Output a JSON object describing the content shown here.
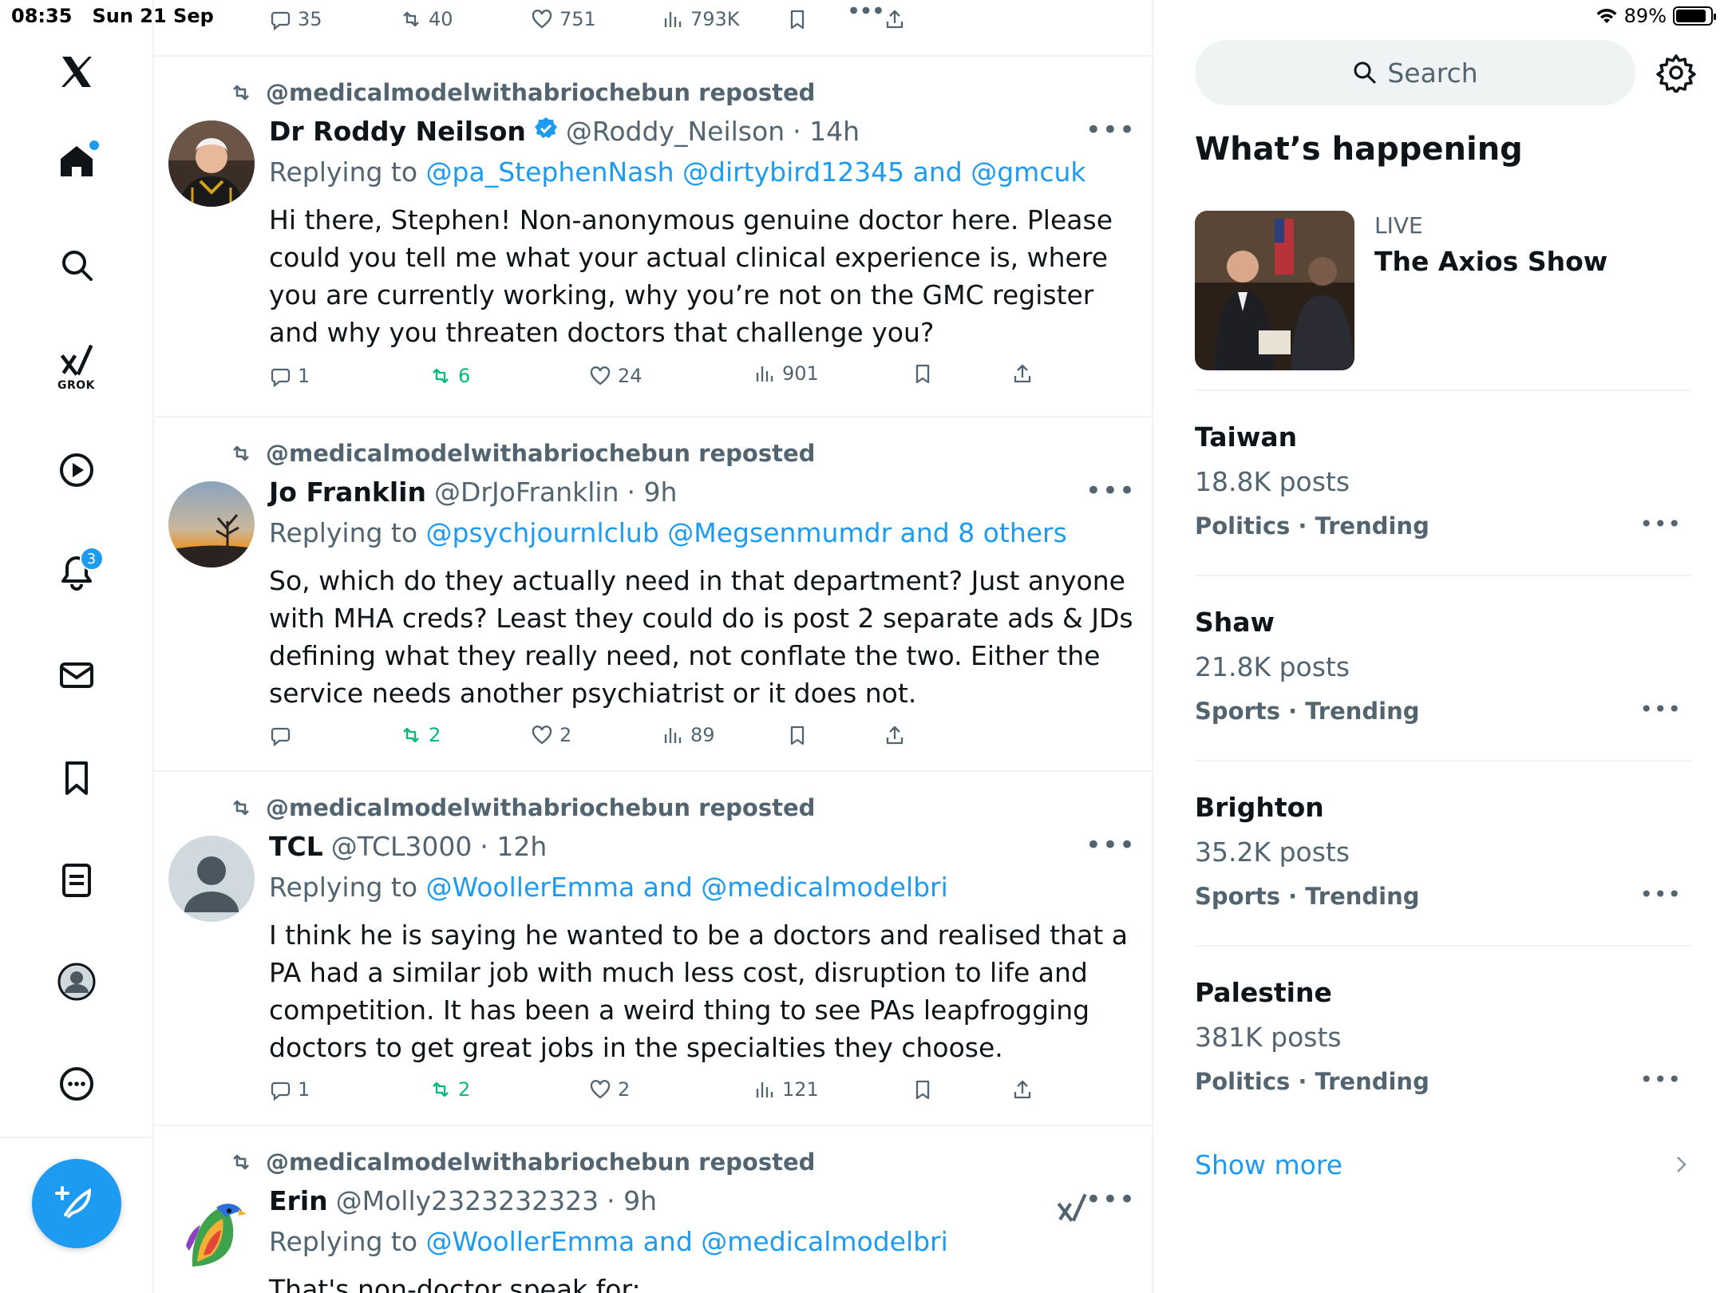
{
  "status_bar": {
    "time": "08:35",
    "date": "Sun 21 Sep",
    "battery": "89%",
    "battery_level": 0.89
  },
  "sidebar": {
    "items": [
      {
        "name": "logo",
        "label": ""
      },
      {
        "name": "home",
        "label": ""
      },
      {
        "name": "explore",
        "label": ""
      },
      {
        "name": "grok",
        "label": "GROK"
      },
      {
        "name": "videos",
        "label": ""
      },
      {
        "name": "notifications",
        "label": "",
        "badge": "3"
      },
      {
        "name": "messages",
        "label": ""
      },
      {
        "name": "bookmarks",
        "label": ""
      },
      {
        "name": "lists",
        "label": ""
      },
      {
        "name": "profile",
        "label": ""
      },
      {
        "name": "more",
        "label": ""
      }
    ]
  },
  "top_post_actions": {
    "replies": "35",
    "reposts": "40",
    "likes": "751",
    "views": "793K"
  },
  "posts": [
    {
      "reposted_by": "@medicalmodelwithabriochebun reposted",
      "author": "Dr Roddy Neilson",
      "verified": true,
      "handle": "@Roddy_Neilson",
      "time": "· 14h",
      "replying_prefix": "Replying to",
      "replying_to": "@pa_StephenNash @dirtybird12345 and @gmcuk",
      "text": "Hi there, Stephen! Non-anonymous genuine doctor here. Please could you tell me what your actual clinical experience is, where you are currently working, why you’re not on the GMC register and why you threaten doctors that challenge you?",
      "replies": "1",
      "reposts": "6",
      "likes": "24",
      "views": "901"
    },
    {
      "reposted_by": "@medicalmodelwithabriochebun reposted",
      "author": "Jo Franklin",
      "verified": false,
      "handle": "@DrJoFranklin",
      "time": "· 9h",
      "replying_prefix": "Replying to",
      "replying_to": "@psychjournlclub @Megsenmumdr and 8 others",
      "text": "So, which do they actually need in that department? Just anyone with MHA creds? Least they could do is post 2 separate ads & JDs defining what they really need, not conflate the two. Either the service needs another psychiatrist or it does not.",
      "replies": "",
      "reposts": "2",
      "likes": "2",
      "views": "89"
    },
    {
      "reposted_by": "@medicalmodelwithabriochebun reposted",
      "author": "TCL",
      "verified": false,
      "handle": "@TCL3000",
      "time": "· 12h",
      "replying_prefix": "Replying to",
      "replying_to": "@WoollerEmma and @medicalmodelbri",
      "text": "I think he is saying he wanted to be a doctors and realised that a PA had a similar job with much less cost, disruption to life and competition. It has been a weird thing to see PAs leapfrogging doctors to get great jobs in the specialties they choose.",
      "replies": "1",
      "reposts": "2",
      "likes": "2",
      "views": "121"
    },
    {
      "reposted_by": "@medicalmodelwithabriochebun reposted",
      "author": "Erin",
      "verified": false,
      "handle": "@Molly2323232323",
      "time": "· 9h",
      "replying_prefix": "Replying to",
      "replying_to": "@WoollerEmma and @medicalmodelbri",
      "text": "That's non-doctor speak for:"
    }
  ],
  "right": {
    "search_placeholder": "Search",
    "section_title": "What’s happening",
    "live": {
      "tag": "LIVE",
      "title": "The Axios Show"
    },
    "trends": [
      {
        "name": "Taiwan",
        "count": "18.8K posts",
        "category": "Politics · Trending"
      },
      {
        "name": "Shaw",
        "count": "21.8K posts",
        "category": "Sports · Trending"
      },
      {
        "name": "Brighton",
        "count": "35.2K posts",
        "category": "Sports · Trending"
      },
      {
        "name": "Palestine",
        "count": "381K posts",
        "category": "Politics · Trending"
      }
    ],
    "show_more": "Show more"
  },
  "colors": {
    "accent": "#1d9bf0",
    "repost_green": "#00ba7c",
    "muted": "#536471",
    "text": "#0f1419",
    "divider": "#eff3f4"
  }
}
